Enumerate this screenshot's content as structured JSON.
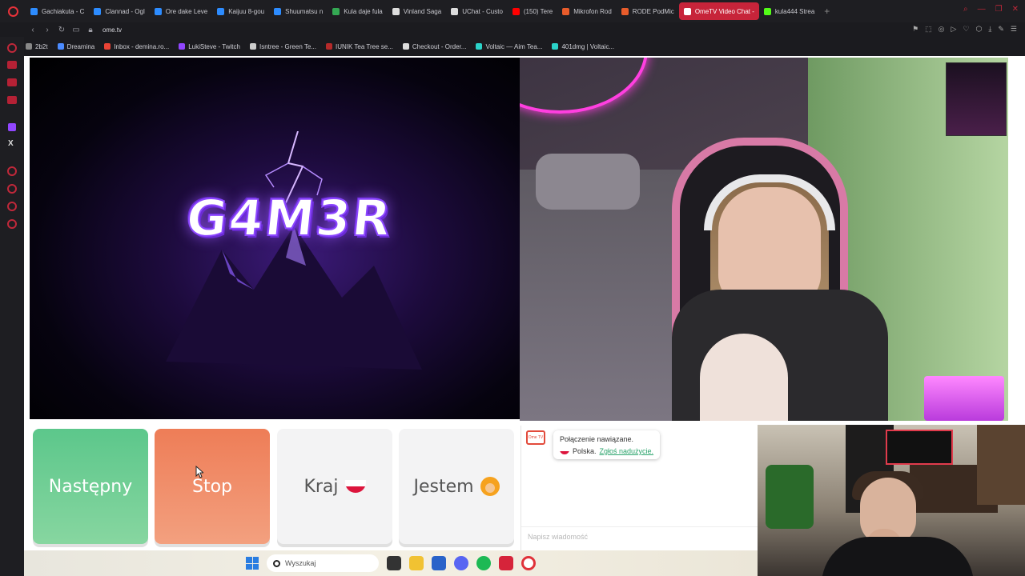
{
  "browser": {
    "tabs": [
      {
        "label": "Gachiakuta - C",
        "color": "#2d8cff",
        "active": false
      },
      {
        "label": "Clannad - Ogl",
        "color": "#2d8cff",
        "active": false
      },
      {
        "label": "Ore dake Leve",
        "color": "#2d8cff",
        "active": false
      },
      {
        "label": "Kaijuu 8-gou",
        "color": "#2d8cff",
        "active": false
      },
      {
        "label": "Shuumatsu n",
        "color": "#2d8cff",
        "active": false
      },
      {
        "label": "Kula daje fula",
        "color": "#34a853",
        "active": false
      },
      {
        "label": "Vinland Saga",
        "color": "#dddddd",
        "active": false
      },
      {
        "label": "UChat - Custo",
        "color": "#dddddd",
        "active": false
      },
      {
        "label": "(150) Tere",
        "color": "#ff0000",
        "active": false
      },
      {
        "label": "Mikrofon Rod",
        "color": "#e85c2b",
        "active": false
      },
      {
        "label": "RODE PodMic",
        "color": "#e85c2b",
        "active": false
      },
      {
        "label": "OmeTV Video Chat -",
        "color": "#ffffff",
        "active": true
      },
      {
        "label": "kula444 Strea",
        "color": "#53fc18",
        "active": false
      }
    ],
    "url": "ome.tv",
    "bookmarks": [
      {
        "label": "2b2t",
        "color": "#888888"
      },
      {
        "label": "Dreamina",
        "color": "#4b8bff"
      },
      {
        "label": "Inbox - demina.ro...",
        "color": "#ea4335"
      },
      {
        "label": "LukiSteve - Twitch",
        "color": "#9146ff"
      },
      {
        "label": "Isntree - Green Te...",
        "color": "#cccccc"
      },
      {
        "label": "IUNIK Tea Tree se...",
        "color": "#b52a2a"
      },
      {
        "label": "Checkout - Order...",
        "color": "#dddddd"
      },
      {
        "label": "Voltaic — Aim Tea...",
        "color": "#2bd3c9"
      },
      {
        "label": "401dmg | Voltaic...",
        "color": "#2bd3c9"
      }
    ]
  },
  "video": {
    "left_logo_text": "G4M3R"
  },
  "controls": {
    "next_label": "Następny",
    "stop_label": "Stop",
    "country_label": "Kraj",
    "gender_label": "Jestem"
  },
  "chat": {
    "logo_text": "Ome TV",
    "connected_text": "Połączenie nawiązane.",
    "country_text": "Polska.",
    "report_text": "Zgłoś nadużycie.",
    "input_placeholder": "Napisz wiadomość"
  },
  "taskbar": {
    "search_placeholder": "Wyszukaj"
  }
}
